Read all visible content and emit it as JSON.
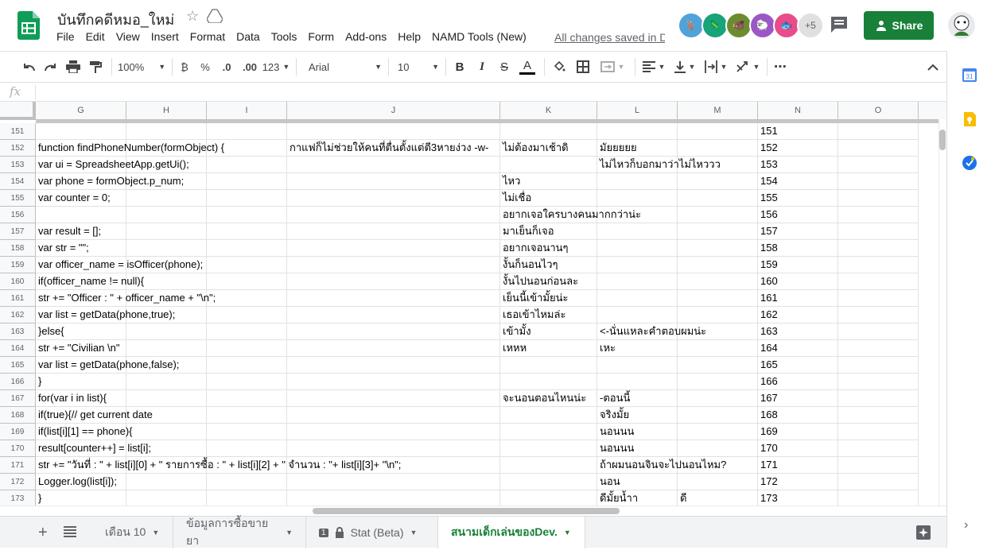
{
  "header": {
    "doc_title": "บันทึกคดีหมอ_ใหม่",
    "save_status": "All changes saved in Drive",
    "share_label": "Share",
    "more_collaborators": "+5",
    "menu": [
      "File",
      "Edit",
      "View",
      "Insert",
      "Format",
      "Data",
      "Tools",
      "Form",
      "Add-ons",
      "Help",
      "NAMD Tools (New)"
    ]
  },
  "toolbar": {
    "zoom": "100%",
    "currency": "₿",
    "percent": "%",
    "dec_decrease": ".0",
    "dec_increase": ".00",
    "number_format": "123",
    "font": "Arial",
    "font_size": "10",
    "bold": "B",
    "italic": "I",
    "strike": "S",
    "text_color_letter": "A",
    "more": "⋯"
  },
  "formula_bar": {
    "fx": "fx",
    "value": ""
  },
  "columns": [
    "G",
    "H",
    "I",
    "J",
    "K",
    "L",
    "M",
    "N",
    "O"
  ],
  "rows": [
    {
      "n": "151",
      "g": "",
      "k": "",
      "l": "",
      "m": ""
    },
    {
      "n": "152",
      "g": "function findPhoneNumber(formObject) {",
      "j": "กาแฟก็ไม่ช่วยให้คนที่ตื่นตั้งแต่ตี3หายง่วง -w-",
      "k": "ไม่ต้องมาเช้าดิ",
      "l": "มัยยยยย",
      "m": ""
    },
    {
      "n": "153",
      "g": "var ui = SpreadsheetApp.getUi();",
      "k": "",
      "l": "ไม่ไหวก็บอกมาว่าไม่ไหววว",
      "m": ""
    },
    {
      "n": "154",
      "g": "var phone = formObject.p_num;",
      "k": "ไหว",
      "l": "",
      "m": ""
    },
    {
      "n": "155",
      "g": "var counter = 0;",
      "k": "ไม่เชื่อ",
      "l": "",
      "m": ""
    },
    {
      "n": "156",
      "g": "",
      "k": "อยากเจอใครบางคนมากกว่าน่ะ",
      "l": "",
      "m": ""
    },
    {
      "n": "157",
      "g": "var result = [];",
      "k": "มาเย็นก็เจอ",
      "l": "",
      "m": ""
    },
    {
      "n": "158",
      "g": "var str = \"\";",
      "k": "อยากเจอนานๆ",
      "l": "",
      "m": ""
    },
    {
      "n": "159",
      "g": "var officer_name = isOfficer(phone);",
      "k": "งั้นก็นอนไวๆ",
      "l": "",
      "m": ""
    },
    {
      "n": "160",
      "g": "if(officer_name != null){",
      "k": "งั้นไปนอนก่อนละ",
      "l": "",
      "m": ""
    },
    {
      "n": "161",
      "g": "str += \"Officer : \" + officer_name + \"\\n\";",
      "k": "เย็นนี้เข้ามั้ยน่ะ",
      "l": "",
      "m": ""
    },
    {
      "n": "162",
      "g": "var list = getData(phone,true);",
      "k": "เธอเข้าไหมล่ะ",
      "l": "",
      "m": ""
    },
    {
      "n": "163",
      "g": "}else{",
      "k": "เข้ามั้ง",
      "l": "<-นั่นแหละคำตอบผมน่ะ",
      "m": ""
    },
    {
      "n": "164",
      "g": "str += \"Civilian \\n\"",
      "k": "เหหห",
      "l": "เหะ",
      "m": ""
    },
    {
      "n": "165",
      "g": "var list = getData(phone,false);",
      "k": "",
      "l": "",
      "m": ""
    },
    {
      "n": "166",
      "g": "}",
      "k": "",
      "l": "",
      "m": ""
    },
    {
      "n": "167",
      "g": "for(var i in list){",
      "k": "จะนอนตอนไหนน่ะ",
      "l": "-ตอนนี้",
      "m": ""
    },
    {
      "n": "168",
      "g": "if(true){// get current date",
      "k": "",
      "l": "จริงมั้ย",
      "m": ""
    },
    {
      "n": "169",
      "g": "if(list[i][1] == phone){",
      "k": "",
      "l": "นอนนน",
      "m": ""
    },
    {
      "n": "170",
      "g": "result[counter++] = list[i];",
      "k": "",
      "l": "นอนนน",
      "m": ""
    },
    {
      "n": "171",
      "g": "str += \"วันที่ : \" + list[i][0] + \" รายการซื้อ : \" + list[i][2] + \" จำนวน : \"+ list[i][3]+ \"\\n\";",
      "k": "",
      "l": "ถ้าผมนอนจินจะไปนอนไหม?",
      "m": ""
    },
    {
      "n": "172",
      "g": "Logger.log(list[i]);",
      "k": "",
      "l": "นอน",
      "m": ""
    },
    {
      "n": "173",
      "g": "}",
      "k": "",
      "l": "ดีมั้ยน้ำา",
      "m": "ดี"
    }
  ],
  "sheets": [
    {
      "label": "เดือน 10",
      "active": false
    },
    {
      "label": "ข้อมูลการซื้อขายยา",
      "active": false
    },
    {
      "label": "Stat (Beta)",
      "active": false,
      "badge": "1"
    },
    {
      "label": "สนามเด็กเล่นของDev.",
      "active": true
    }
  ],
  "colors": {
    "green": "#188038",
    "sheets_green": "#0f9d58"
  }
}
